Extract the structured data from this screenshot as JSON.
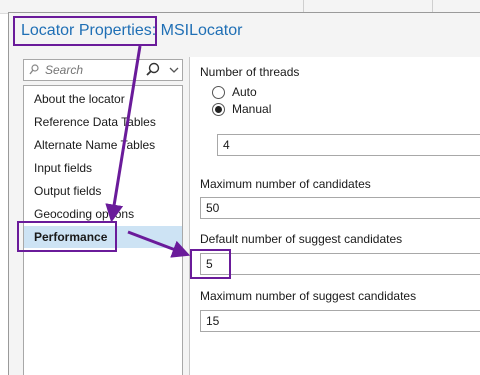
{
  "dialog": {
    "title": "Locator Properties: MSILocator"
  },
  "search": {
    "placeholder": "Search",
    "search_icon": "search-icon",
    "dropdown_icon": "chevron-down-icon"
  },
  "nav": {
    "items": [
      {
        "label": "About the locator"
      },
      {
        "label": "Reference Data Tables"
      },
      {
        "label": "Alternate Name Tables"
      },
      {
        "label": "Input fields"
      },
      {
        "label": "Output fields"
      },
      {
        "label": "Geocoding options"
      },
      {
        "label": "Performance",
        "selected": true
      }
    ]
  },
  "performance": {
    "threads_label": "Number of threads",
    "auto_label": "Auto",
    "manual_label": "Manual",
    "thread_mode": "Manual",
    "threads_value": "4",
    "max_candidates_label": "Maximum number of candidates",
    "max_candidates_value": "50",
    "default_suggest_label": "Default number of suggest candidates",
    "default_suggest_value": "5",
    "max_suggest_label": "Maximum number of suggest candidates",
    "max_suggest_value": "15"
  },
  "colors": {
    "annotation": "#6a1b9a",
    "title_text": "#1f6fb5",
    "selected_row": "#cde3f4"
  }
}
